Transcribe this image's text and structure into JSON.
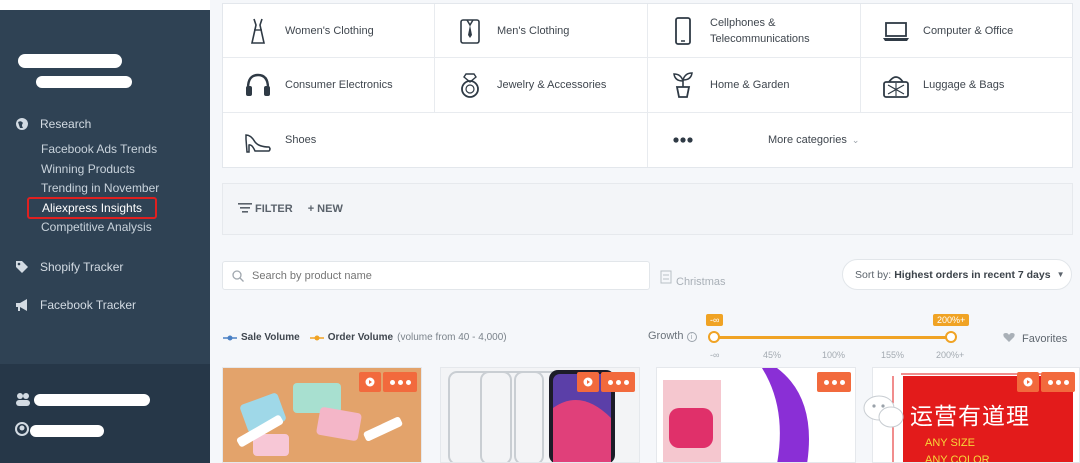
{
  "sidebar": {
    "research_label": "Research",
    "research_items": [
      {
        "label": "Facebook Ads Trends"
      },
      {
        "label": "Winning Products"
      },
      {
        "label": "Trending in November"
      },
      {
        "label": "Aliexpress Insights"
      },
      {
        "label": "Competitive Analysis"
      }
    ],
    "shopify_label": "Shopify Tracker",
    "facebook_label": "Facebook Tracker"
  },
  "categories": [
    {
      "label": "Women's Clothing",
      "icon": "dress-icon"
    },
    {
      "label": "Men's Clothing",
      "icon": "shirt-tie-icon"
    },
    {
      "label": "Cellphones &\nTelecommunications",
      "icon": "cellphone-icon"
    },
    {
      "label": "Computer & Office",
      "icon": "laptop-icon"
    },
    {
      "label": "Consumer Electronics",
      "icon": "headphones-icon"
    },
    {
      "label": "Jewelry & Accessories",
      "icon": "ring-icon"
    },
    {
      "label": "Home & Garden",
      "icon": "plant-icon"
    },
    {
      "label": "Luggage & Bags",
      "icon": "basket-icon"
    },
    {
      "label": "Shoes",
      "icon": "high-heel-icon"
    },
    {
      "label": "More categories",
      "icon": "more-dots-icon"
    }
  ],
  "filterbar": {
    "filter_label": "FILTER",
    "new_label": "+ NEW"
  },
  "search": {
    "placeholder": "Search by product name"
  },
  "christmas_label": "Christmas",
  "sort": {
    "prefix": "Sort by:",
    "value": "Highest orders in recent 7 days"
  },
  "legend": {
    "sale": "Sale Volume",
    "order": "Order Volume",
    "note": "(volume from 40 - 4,000)"
  },
  "growth": {
    "label": "Growth",
    "min_tip": "-∞",
    "max_tip": "200%+",
    "ticks": [
      "-∞",
      "45%",
      "100%",
      "155%",
      "200%+"
    ]
  },
  "favorites_label": "Favorites",
  "overlay_watermark": "运营有道理",
  "card4_text": {
    "line1": "ANY SIZE",
    "line2": "ANY COLOR"
  },
  "colors": {
    "accent": "#f0a324",
    "action": "#f26a3d",
    "sidebar": "#2f4254",
    "highlight": "#e02020"
  }
}
